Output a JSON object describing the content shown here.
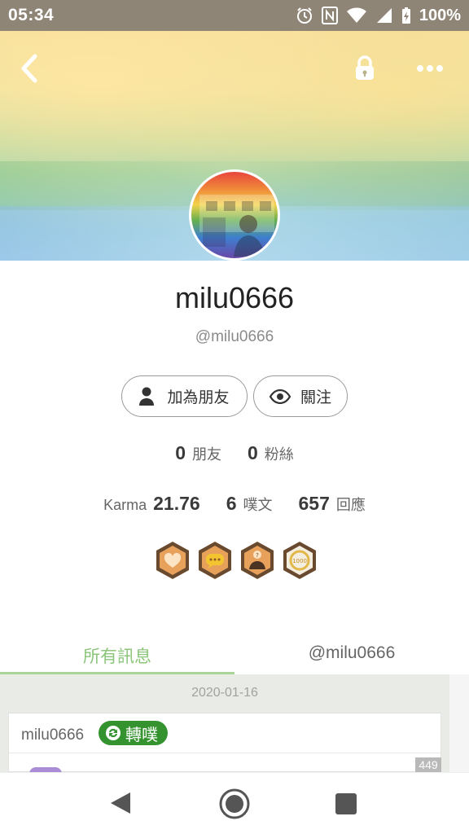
{
  "status_bar": {
    "time": "05:34",
    "battery": "100%"
  },
  "profile": {
    "display_name": "milu0666",
    "handle": "@milu0666",
    "add_friend_label": "加為朋友",
    "follow_label": "關注"
  },
  "stats": {
    "friends_count": "0",
    "friends_label": "朋友",
    "fans_count": "0",
    "fans_label": "粉絲",
    "karma_label": "Karma",
    "karma_value": "21.76",
    "plurks_count": "6",
    "plurks_label": "噗文",
    "responses_count": "657",
    "responses_label": "回應"
  },
  "badges": [
    "heart-badge-icon",
    "chat-badge-icon",
    "question-user-badge-icon",
    "1000-badge-icon"
  ],
  "tabs": {
    "all_label": "所有訊息",
    "mentions_label": "@milu0666"
  },
  "timeline": {
    "date": "2020-01-16",
    "post_user": "milu0666",
    "replurk_label": "轉噗",
    "response_count": "449"
  },
  "colors": {
    "accent_green": "#8bc57a",
    "replurk_green": "#34922f",
    "status_bar": "#8f8576"
  }
}
